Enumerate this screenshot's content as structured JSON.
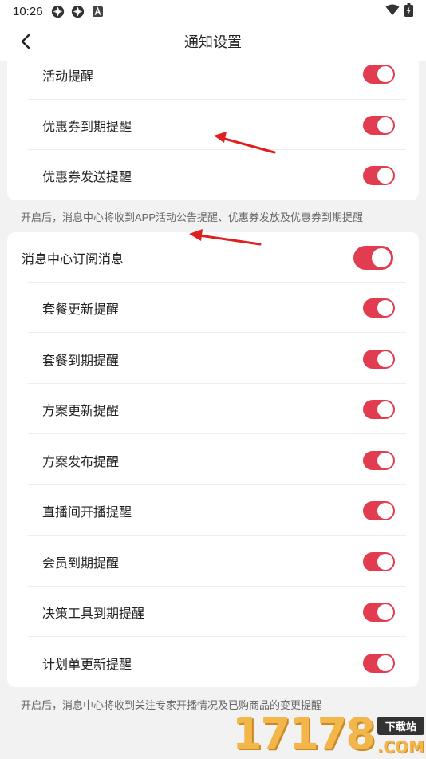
{
  "status_bar": {
    "time": "10:26",
    "left_icons": [
      "aperture-icon",
      "aperture-icon",
      "font-a-icon"
    ],
    "right_icons": [
      "wifi-icon",
      "battery-charging-icon"
    ]
  },
  "nav": {
    "title": "通知设置",
    "back_icon": "chevron-left-icon"
  },
  "section_activity": {
    "items": [
      {
        "label": "活动提醒",
        "enabled": true
      },
      {
        "label": "优惠券到期提醒",
        "enabled": true
      },
      {
        "label": "优惠券发送提醒",
        "enabled": true
      }
    ],
    "note": "开启后，消息中心将收到APP活动公告提醒、优惠券发放及优惠券到期提醒"
  },
  "section_subscription": {
    "master": {
      "label": "消息中心订阅消息",
      "enabled": true
    },
    "items": [
      {
        "label": "套餐更新提醒",
        "enabled": true
      },
      {
        "label": "套餐到期提醒",
        "enabled": true
      },
      {
        "label": "方案更新提醒",
        "enabled": true
      },
      {
        "label": "方案发布提醒",
        "enabled": true
      },
      {
        "label": "直播间开播提醒",
        "enabled": true
      },
      {
        "label": "会员到期提醒",
        "enabled": true
      },
      {
        "label": "决策工具到期提醒",
        "enabled": true
      },
      {
        "label": "计划单更新提醒",
        "enabled": true
      }
    ],
    "note": "开启后，消息中心将收到关注专家开播情况及已购商品的变更提醒"
  },
  "colors": {
    "toggle_on": "#e13c4f",
    "background": "#f2f2f2",
    "annotation_arrow": "#e02020"
  },
  "watermark": {
    "digits": "17178",
    "tag": "下载站",
    "suffix": ".COM"
  }
}
